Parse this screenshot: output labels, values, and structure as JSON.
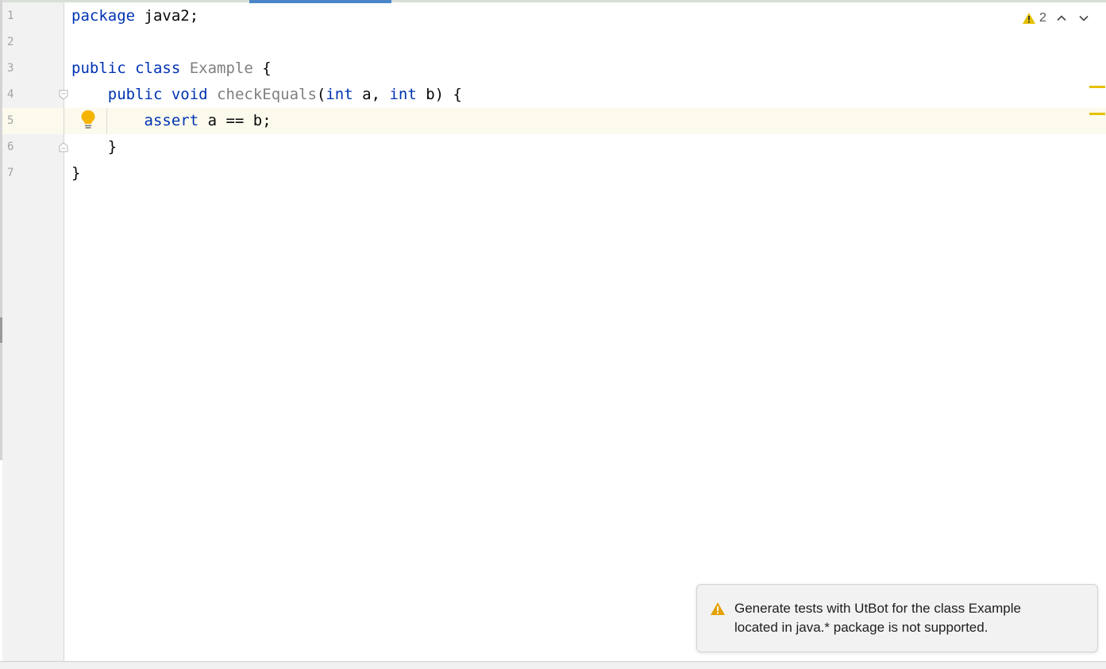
{
  "editor": {
    "line_numbers": [
      "1",
      "2",
      "3",
      "4",
      "5",
      "6",
      "7"
    ],
    "lines": [
      [
        {
          "t": "package",
          "c": "kw"
        },
        {
          "t": " java2;",
          "c": ""
        }
      ],
      [],
      [
        {
          "t": "public class",
          "c": "kw"
        },
        {
          "t": " ",
          "c": ""
        },
        {
          "t": "Example",
          "c": "gray"
        },
        {
          "t": " {",
          "c": ""
        }
      ],
      [
        {
          "t": "    ",
          "c": ""
        },
        {
          "t": "public void",
          "c": "kw"
        },
        {
          "t": " ",
          "c": ""
        },
        {
          "t": "checkEquals",
          "c": "gray"
        },
        {
          "t": "(",
          "c": ""
        },
        {
          "t": "int",
          "c": "kw"
        },
        {
          "t": " a, ",
          "c": ""
        },
        {
          "t": "int",
          "c": "kw"
        },
        {
          "t": " b) {",
          "c": ""
        }
      ],
      [
        {
          "t": "        ",
          "c": ""
        },
        {
          "t": "assert",
          "c": "kw"
        },
        {
          "t": " a == b;",
          "c": ""
        }
      ],
      [
        {
          "t": "    }",
          "c": ""
        }
      ],
      [
        {
          "t": "}",
          "c": ""
        }
      ]
    ],
    "current_line": 5
  },
  "inspections": {
    "warning_count": "2",
    "icon": "warning-triangle-icon"
  },
  "notification": {
    "icon": "warning-triangle-icon",
    "line1": "Generate tests with UtBot for the class Example",
    "line2": "located in java.* package is not supported."
  },
  "colors": {
    "keyword": "#0033b3",
    "identifier_unused": "#808080",
    "warning": "#e5c000",
    "current_line_bg": "#fcfaed",
    "tab_accent": "#4a86c8"
  }
}
